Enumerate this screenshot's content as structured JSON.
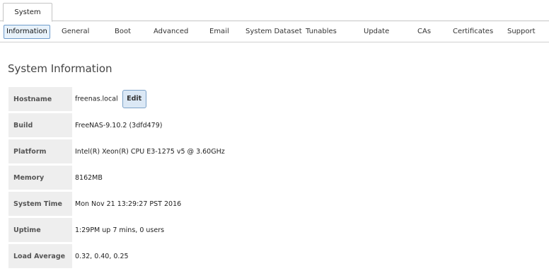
{
  "outer_tabs": [
    {
      "label": "System"
    }
  ],
  "sub_tabs": [
    {
      "label": "Information",
      "active": true
    },
    {
      "label": "General"
    },
    {
      "label": "Boot"
    },
    {
      "label": "Advanced"
    },
    {
      "label": "Email"
    },
    {
      "label": "System Dataset"
    },
    {
      "label": "Tunables"
    },
    {
      "label": "Update"
    },
    {
      "label": "CAs"
    },
    {
      "label": "Certificates"
    },
    {
      "label": "Support"
    }
  ],
  "section": {
    "title": "System Information"
  },
  "info": {
    "hostname": {
      "label": "Hostname",
      "value": "freenas.local",
      "edit_label": "Edit"
    },
    "build": {
      "label": "Build",
      "value": "FreeNAS-9.10.2 (3dfd479)"
    },
    "platform": {
      "label": "Platform",
      "value": "Intel(R) Xeon(R) CPU E3-1275 v5 @ 3.60GHz"
    },
    "memory": {
      "label": "Memory",
      "value": "8162MB"
    },
    "system_time": {
      "label": "System Time",
      "value": "Mon Nov 21 13:29:27 PST 2016"
    },
    "uptime": {
      "label": "Uptime",
      "value": "1:29PM up 7 mins, 0 users"
    },
    "load_average": {
      "label": "Load Average",
      "value": "0.32, 0.40, 0.25"
    }
  }
}
